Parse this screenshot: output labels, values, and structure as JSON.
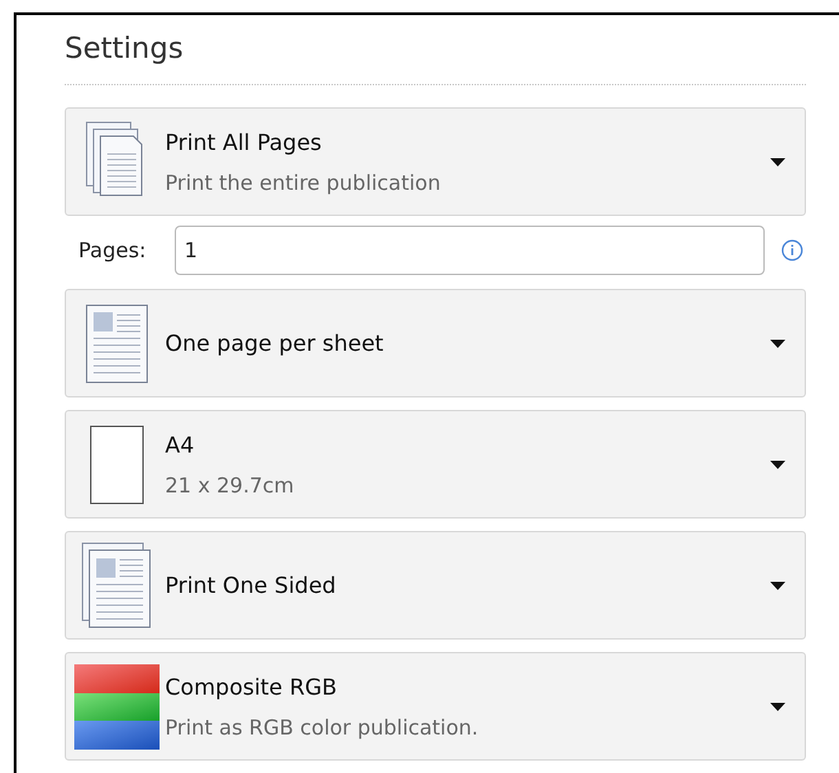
{
  "title": "Settings",
  "dropdowns_top": [
    {
      "kind": "pages",
      "label": "Print All Pages",
      "description": "Print the entire publication"
    }
  ],
  "pages_field": {
    "label": "Pages:",
    "value": "1"
  },
  "dropdowns": [
    {
      "kind": "layout",
      "label": "One page per sheet"
    },
    {
      "kind": "paper",
      "label": "A4",
      "description": "21 x 29.7cm"
    },
    {
      "kind": "duplex",
      "label": "Print One Sided"
    },
    {
      "kind": "color",
      "label": "Composite RGB",
      "description": "Print as RGB color publication."
    }
  ]
}
